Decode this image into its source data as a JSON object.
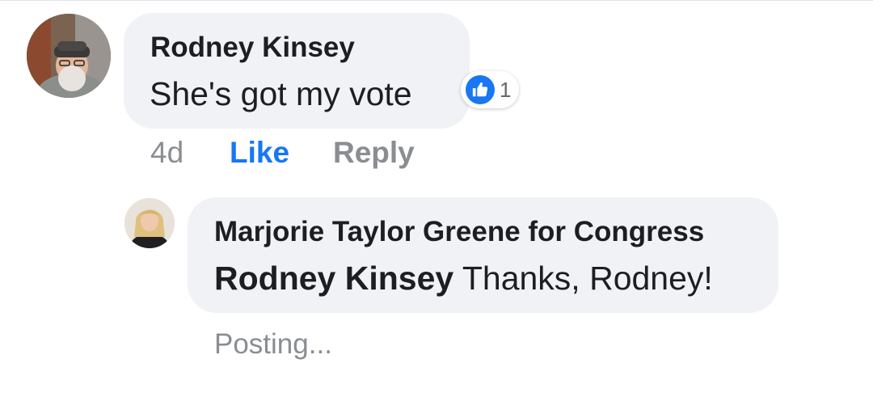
{
  "comment": {
    "author": "Rodney Kinsey",
    "text": "She's got my vote",
    "reaction": {
      "icon": "thumbs-up-icon",
      "color": "#1877f2",
      "count": "1"
    },
    "timestamp": "4d",
    "like_label": "Like",
    "reply_label": "Reply"
  },
  "reply": {
    "author": "Marjorie Taylor Greene for Congress",
    "mention": "Rodney Kinsey",
    "text": " Thanks, Rodney!",
    "status": "Posting..."
  },
  "colors": {
    "accent": "#1877f2",
    "bubble": "#f0f2f5",
    "muted_text": "#8a8d91"
  }
}
